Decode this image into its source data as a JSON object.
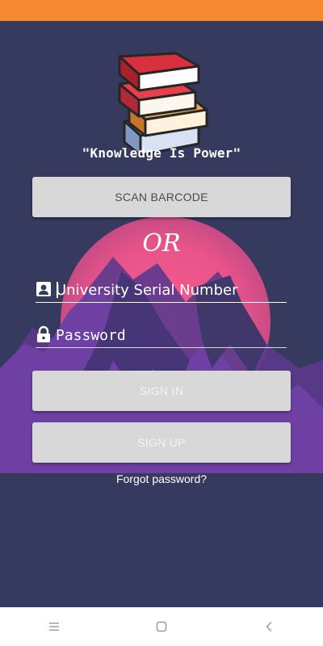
{
  "app": {
    "tagline": "\"Knowledge Is Power\"",
    "scan_button_label": "SCAN BARCODE",
    "or_label": "OR",
    "serial_field": {
      "placeholder": "University Serial Number",
      "value": ""
    },
    "password_field": {
      "placeholder": "Password",
      "value": ""
    },
    "signin_button_label": "SIGN IN",
    "signup_button_label": "SIGN UP",
    "forgot_password_label": "Forgot password?"
  },
  "icons": {
    "logo": "stacked-books-icon",
    "serial_field": "contact-card-icon",
    "password_field": "lock-icon",
    "nav_menu": "menu-icon",
    "nav_home": "square-home-icon",
    "nav_back": "back-chevron-icon"
  },
  "colors": {
    "status_bar": "#f58a33",
    "background": "#363a5e",
    "sun": "#ef5a8e",
    "mountain": "#6f3f9e",
    "button": "#d8d8d8"
  }
}
